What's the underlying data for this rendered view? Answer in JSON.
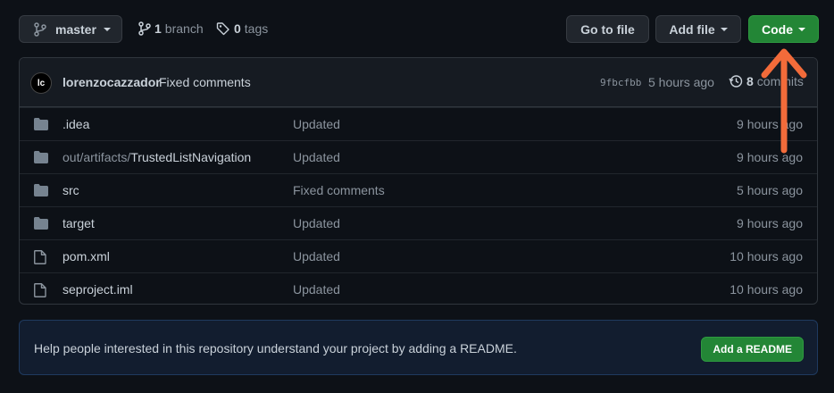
{
  "branch_selector": {
    "label": "master"
  },
  "branches": {
    "count": "1",
    "label": "branch"
  },
  "tags": {
    "count": "0",
    "label": "tags"
  },
  "toolbar": {
    "go_to_file": "Go to file",
    "add_file": "Add file",
    "code": "Code"
  },
  "latest_commit": {
    "avatar_text": "lc",
    "author": "lorenzocazzador",
    "message": "Fixed comments",
    "sha": "9fbcfbb",
    "time": "5 hours ago",
    "commits_count": "8",
    "commits_label": "commits"
  },
  "files": [
    {
      "type": "folder",
      "prefix": "",
      "name": ".idea",
      "message": "Updated",
      "age": "9 hours ago"
    },
    {
      "type": "folder",
      "prefix": "out/artifacts/",
      "name": "TrustedListNavigation",
      "message": "Updated",
      "age": "9 hours ago"
    },
    {
      "type": "folder",
      "prefix": "",
      "name": "src",
      "message": "Fixed comments",
      "age": "5 hours ago"
    },
    {
      "type": "folder",
      "prefix": "",
      "name": "target",
      "message": "Updated",
      "age": "9 hours ago"
    },
    {
      "type": "file",
      "prefix": "",
      "name": "pom.xml",
      "message": "Updated",
      "age": "10 hours ago"
    },
    {
      "type": "file",
      "prefix": "",
      "name": "seproject.iml",
      "message": "Updated",
      "age": "10 hours ago"
    }
  ],
  "readme_banner": {
    "text": "Help people interested in this repository understand your project by adding a README.",
    "button": "Add a README"
  },
  "colors": {
    "accent_green": "#238636",
    "annotation_arrow": "#f26b3a",
    "background": "#0d1117"
  }
}
